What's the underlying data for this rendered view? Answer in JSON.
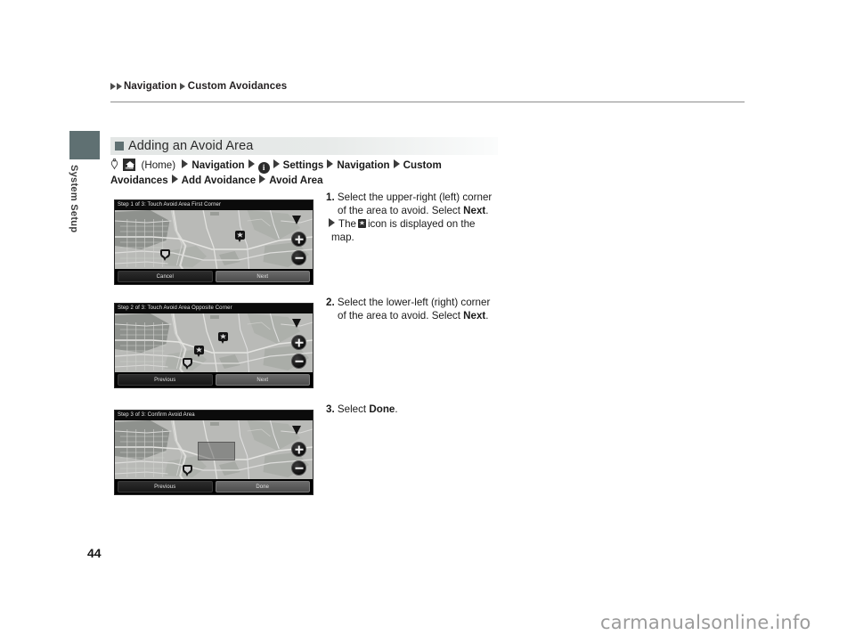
{
  "breadcrumb": {
    "items": [
      "Navigation",
      "Custom Avoidances"
    ]
  },
  "sidebar": {
    "tab_label": "System Setup"
  },
  "section": {
    "title": "Adding an Avoid Area"
  },
  "path": {
    "home_label": "(Home)",
    "home_icon_word": "HOME",
    "info_icon_char": "i",
    "segments": [
      "Navigation",
      "Settings",
      "Navigation",
      "Custom Avoidances",
      "Add Avoidance",
      "Avoid Area"
    ]
  },
  "screens": [
    {
      "title": "Step 1 of 3: Touch Avoid Area First Corner",
      "buttons": [
        {
          "label": "Cancel",
          "style": "dark"
        },
        {
          "label": "Next",
          "style": "light"
        }
      ]
    },
    {
      "title": "Step 2 of 3: Touch Avoid Area Opposite Corner",
      "buttons": [
        {
          "label": "Previous",
          "style": "dark"
        },
        {
          "label": "Next",
          "style": "light"
        }
      ]
    },
    {
      "title": "Step 3 of 3: Confirm Avoid Area",
      "buttons": [
        {
          "label": "Previous",
          "style": "dark"
        },
        {
          "label": "Done",
          "style": "light"
        }
      ]
    }
  ],
  "instructions": [
    {
      "num": "1.",
      "line1": "Select the upper-right (left) corner",
      "line2_pre": "of the area to avoid. Select ",
      "line2_bold": "Next",
      "line2_post": ".",
      "sub_pre": "The",
      "sub_post": "icon is displayed on the",
      "sub_cont": "map."
    },
    {
      "num": "2.",
      "line1": "Select the lower-left (right) corner",
      "line2_pre": "of the area to avoid. Select ",
      "line2_bold": "Next",
      "line2_post": "."
    },
    {
      "num": "3.",
      "line1_pre": "Select ",
      "line1_bold": "Done",
      "line1_post": "."
    }
  ],
  "footer": {
    "page_number": "44",
    "watermark": "carmanualsonline.info"
  },
  "colors": {
    "accent": "#5f7072",
    "rule": "#8c8c8c",
    "text": "#1a1a1a",
    "map_base": "#b9bab7"
  }
}
